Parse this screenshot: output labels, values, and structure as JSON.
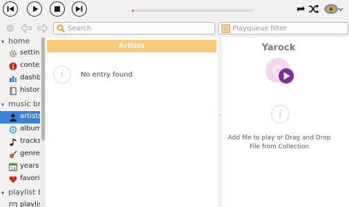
{
  "player": {
    "buttons": [
      "previous",
      "play",
      "stop",
      "next"
    ],
    "progress_fraction": 0.01
  },
  "toolbar": {
    "icons": [
      "repeat-icon",
      "shuffle-icon",
      "volume-icon"
    ]
  },
  "search": {
    "placeholder": "Search"
  },
  "playqueue_filter": {
    "placeholder": "Playqueue filter"
  },
  "sidebar": {
    "sections": [
      {
        "label": "home",
        "items": [
          {
            "label": "settings",
            "icon": "gear-icon"
          },
          {
            "label": "context",
            "icon": "info-icon"
          },
          {
            "label": "dashboard",
            "icon": "dashboard-icon"
          },
          {
            "label": "history",
            "icon": "history-icon"
          }
        ]
      },
      {
        "label": "music browser",
        "items": [
          {
            "label": "artists",
            "icon": "person-icon",
            "selected": true
          },
          {
            "label": "albums",
            "icon": "cd-icon"
          },
          {
            "label": "tracks",
            "icon": "note-icon"
          },
          {
            "label": "genre",
            "icon": "guitar-icon"
          },
          {
            "label": "years",
            "icon": "calendar-icon"
          },
          {
            "label": "favorites",
            "icon": "heart-icon"
          }
        ]
      },
      {
        "label": "playlist browser",
        "items": [
          {
            "label": "playlists",
            "icon": "playlist-icon"
          }
        ]
      }
    ]
  },
  "center": {
    "header": "Artists",
    "empty_text": "No entry found"
  },
  "right": {
    "title": "Yarock",
    "hint": "Add file to play or Drag and Drop File from Collection"
  },
  "colors": {
    "accent": "#3a82d6",
    "header_orange": "#fbc978",
    "info_pink": "#e2c0ee",
    "play_purple": "#7a2f9a"
  }
}
